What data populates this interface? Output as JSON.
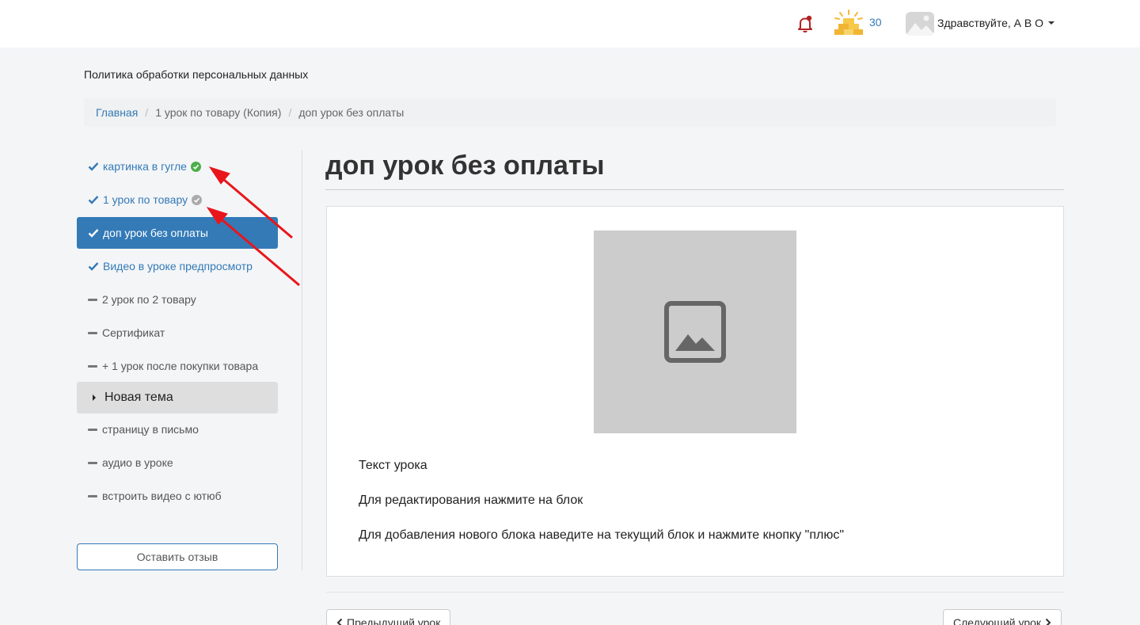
{
  "header": {
    "notification_count": "30",
    "greeting": "Здравствуйте, А В О"
  },
  "policy_link": "Политика обработки персональных данных",
  "breadcrumb": {
    "home": "Главная",
    "section": "1 урок по товару (Копия)",
    "current": "доп урок без оплаты"
  },
  "sidebar": {
    "lessons": [
      {
        "label": "картинка в гугле",
        "state": "completed"
      },
      {
        "label": "1 урок по товару",
        "state": "available"
      },
      {
        "label": "доп урок без оплаты",
        "state": "active"
      },
      {
        "label": "Видео в уроке предпросмотр",
        "state": "available"
      },
      {
        "label": "2 урок по 2 товару",
        "state": "locked"
      },
      {
        "label": "Сертификат",
        "state": "locked"
      },
      {
        "label": "+ 1 урок после покупки товара",
        "state": "locked"
      }
    ],
    "topic": "Новая тема",
    "topic_lessons": [
      {
        "label": "страницу в письмо",
        "state": "locked"
      },
      {
        "label": "аудио в уроке",
        "state": "locked"
      },
      {
        "label": "встроить видео с ютюб",
        "state": "locked"
      }
    ],
    "feedback_button": "Оставить отзыв"
  },
  "main": {
    "title": "доп урок без оплаты",
    "paragraphs": [
      "Текст урока",
      "Для редактирования нажмите на блок",
      "Для добавления нового блока наведите на текущий блок и нажмите кнопку \"плюс\""
    ],
    "prev_button": "Предыдущий урок",
    "next_button": "Следующий урок"
  },
  "colors": {
    "accent": "#337ab7",
    "success": "#4cae4c",
    "bell": "#b22222",
    "annotation": "#e8161b"
  },
  "icons": [
    "bell-icon",
    "coins-icon",
    "avatar-image-icon",
    "check-icon",
    "dash-icon",
    "image-placeholder-icon",
    "chevron-left-icon",
    "chevron-right-icon"
  ]
}
